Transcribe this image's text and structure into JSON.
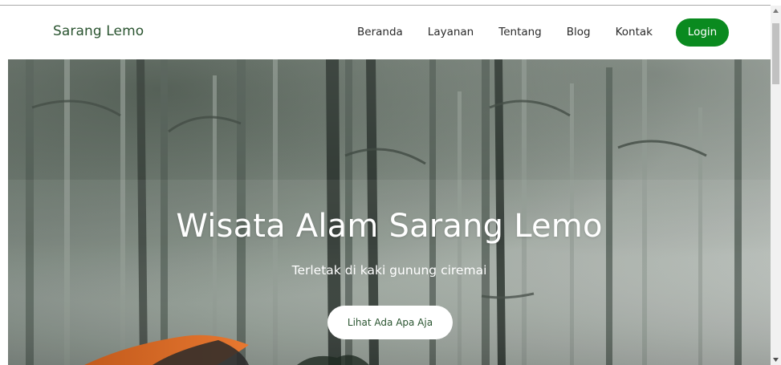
{
  "colors": {
    "accent": "#0a8a1f",
    "brand_text": "#2a5430"
  },
  "navbar": {
    "brand": "Sarang Lemo",
    "links": [
      "Beranda",
      "Layanan",
      "Tentang",
      "Blog",
      "Kontak"
    ],
    "login_label": "Login"
  },
  "hero": {
    "background_icon": "foggy-forest-with-tent-image",
    "title": "Wisata Alam Sarang Lemo",
    "subtitle": "Terletak di kaki gunung ciremai",
    "cta_label": "Lihat Ada Apa Aja"
  },
  "scrollbar": {
    "up_icon": "arrow-up-icon",
    "down_icon": "arrow-down-icon"
  }
}
